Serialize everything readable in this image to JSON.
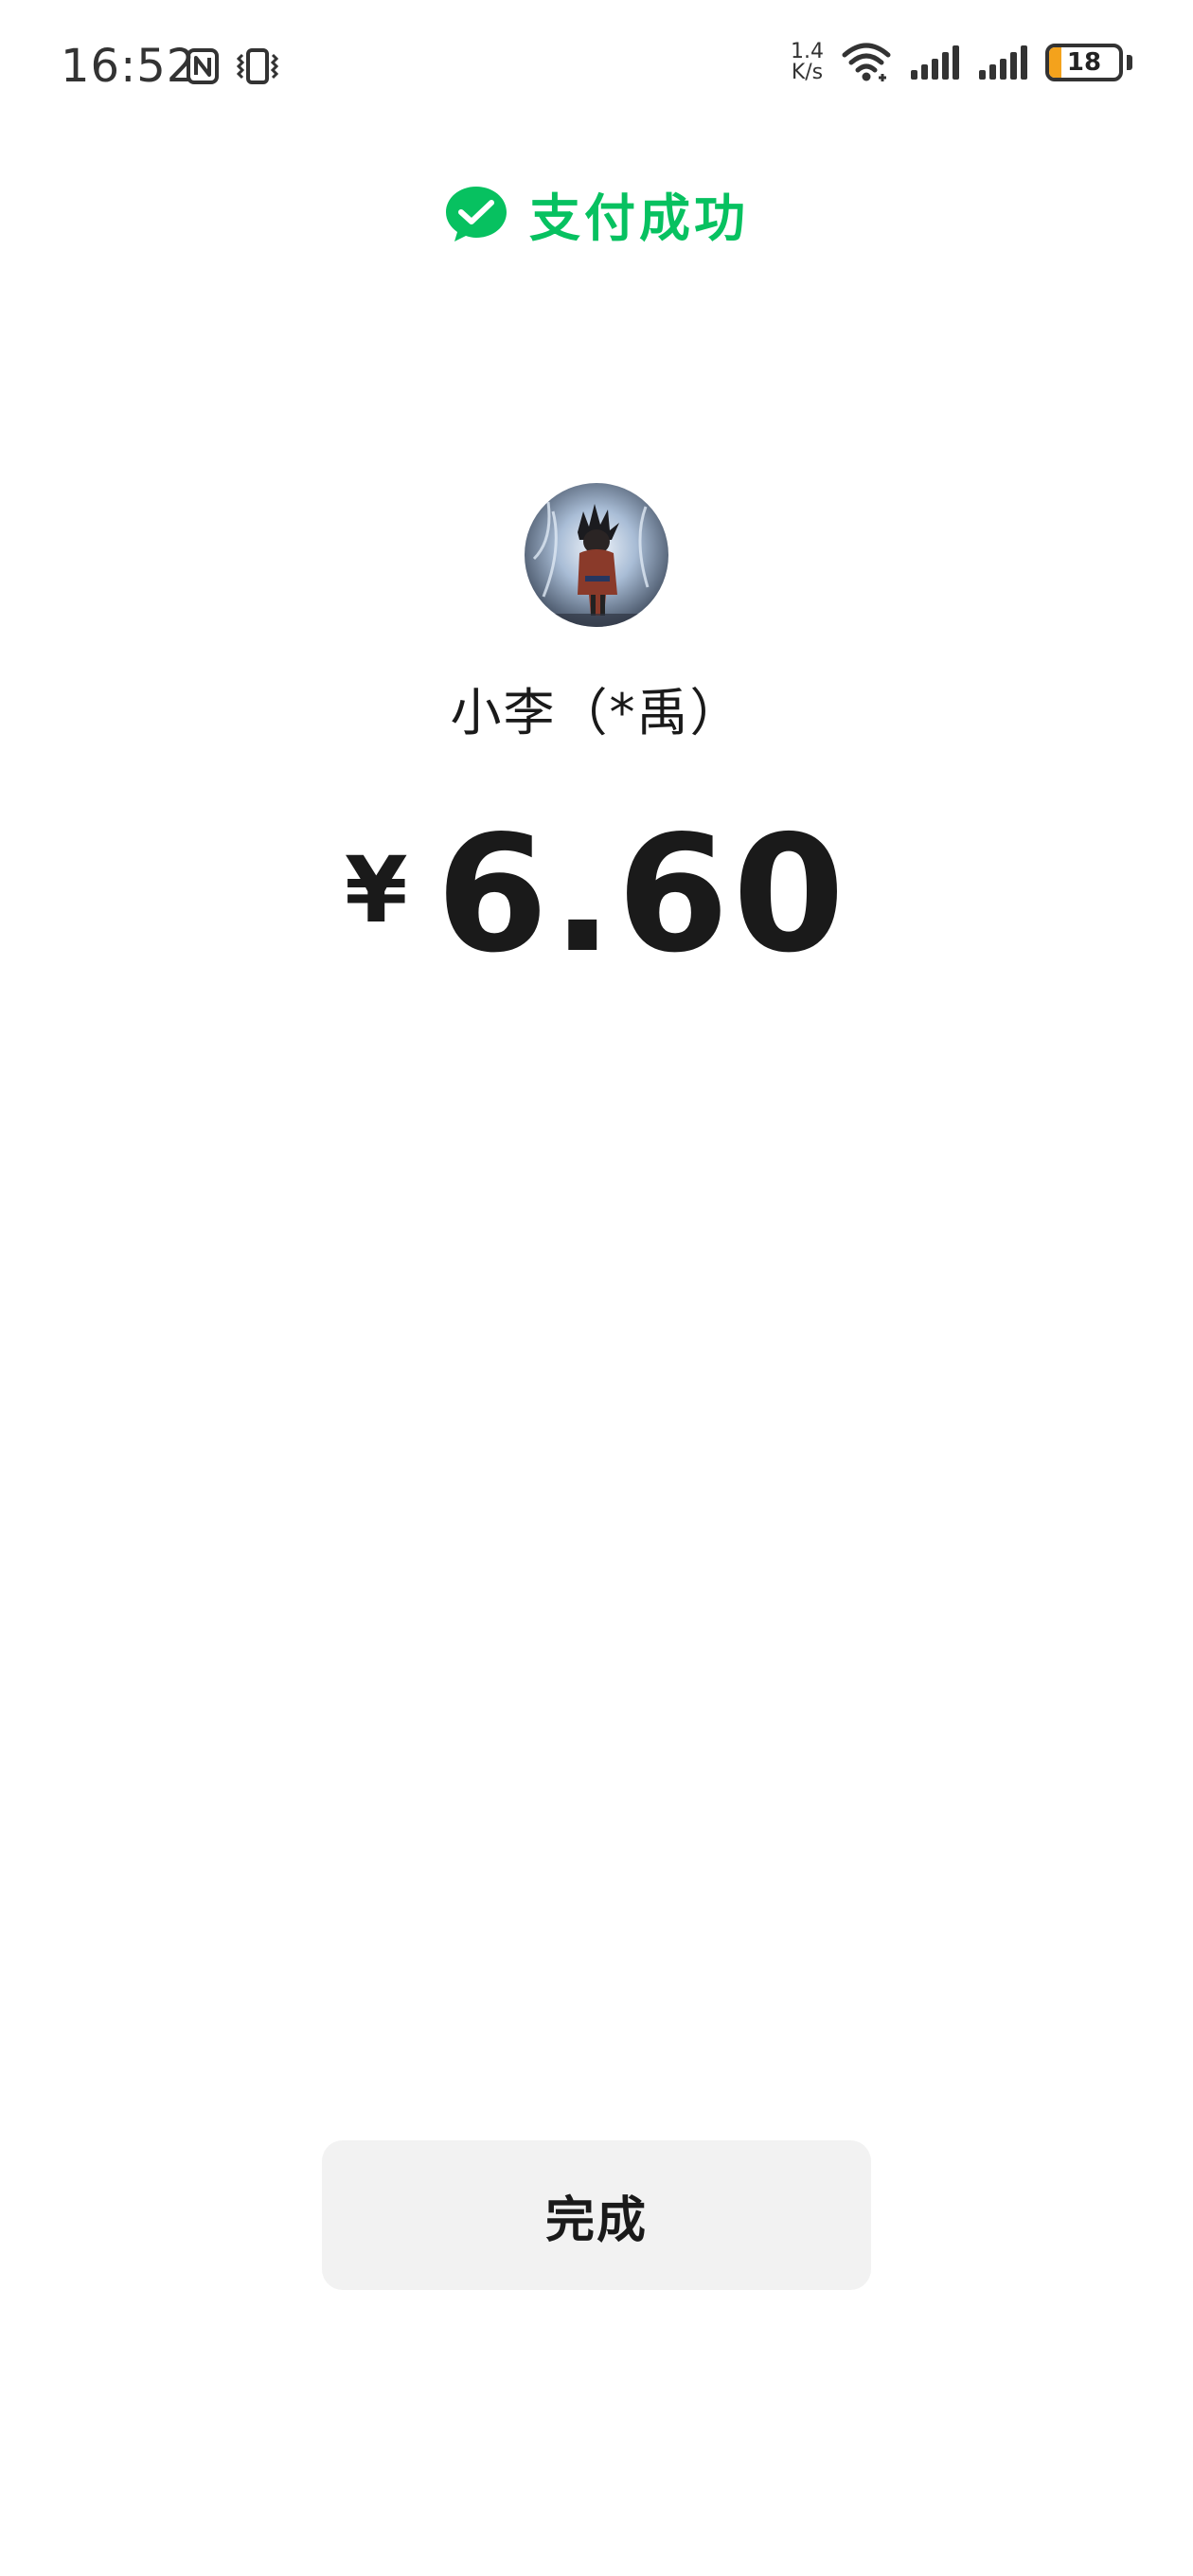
{
  "status_bar": {
    "time": "16:52",
    "net_speed_value": "1.4",
    "net_speed_unit": "K/s",
    "battery_level": "18",
    "battery_fraction": 0.18,
    "battery_color": "#f4a21c",
    "icons": [
      "nfc-icon",
      "vibrate-icon",
      "wifi-icon",
      "signal-icon",
      "signal-icon",
      "battery-icon"
    ]
  },
  "payment": {
    "status_title": "支付成功",
    "status_icon": "wechat-icon",
    "accent_color": "#07c160",
    "payee_name": "小李（*禹）",
    "currency_symbol": "¥",
    "amount": "6.60"
  },
  "actions": {
    "done_label": "完成"
  }
}
